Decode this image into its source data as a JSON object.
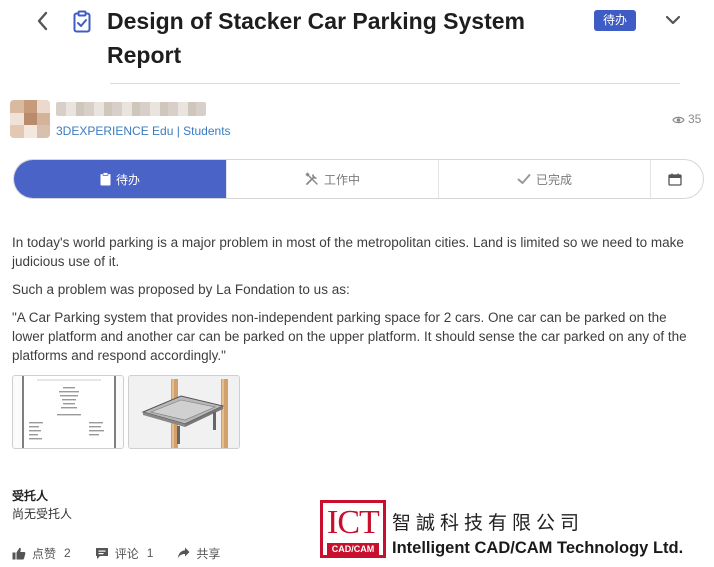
{
  "header": {
    "title": "Design of Stacker Car Parking System Report",
    "status_chip": "待办"
  },
  "author": {
    "org": "3DEXPERIENCE Edu | Students",
    "views": "35"
  },
  "tabs": {
    "todo": "待办",
    "in_progress": "工作中",
    "done": "已完成"
  },
  "description": {
    "p1": "In today's world parking is a major problem in most of the metropolitan cities. Land is limited so we need to make judicious use of it.",
    "p2": "Such a problem was proposed by La Fondation to us as:",
    "p3": "\"A Car Parking system that provides non-independent parking space for 2 cars. One car can be parked on the lower platform and another car can be parked on the upper platform. It should sense the car parked on any of the platforms and respond accordingly.\""
  },
  "assignee": {
    "label": "受托人",
    "value": "尚无受托人"
  },
  "actions": {
    "like_label": "点赞",
    "like_count": "2",
    "comment_label": "评论",
    "comment_count": "1",
    "share_label": "共享"
  },
  "watermark": {
    "logo_text": "ICT",
    "logo_sub": "CAD/CAM",
    "company_cn": "智誠科技有限公司",
    "company_en": "Intelligent CAD/CAM Technology Ltd."
  },
  "colors": {
    "accent": "#4a63c6",
    "link": "#3b7bbf",
    "brand_red": "#c8102e"
  }
}
